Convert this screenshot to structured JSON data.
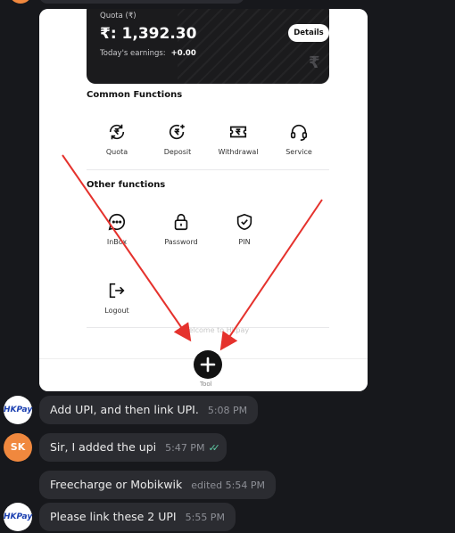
{
  "screenshot": {
    "quota_label": "Quota (₹)",
    "quota_amount": "₹: 1,392.30",
    "today_label": "Today's earnings:",
    "today_value": "+0.00",
    "details_label": "Details",
    "common_title": "Common Functions",
    "common_functions": [
      {
        "label": "Quota",
        "icon": "rupee-refresh-icon"
      },
      {
        "label": "Deposit",
        "icon": "rupee-plus-icon"
      },
      {
        "label": "Withdrawal",
        "icon": "ticket-rupee-icon"
      },
      {
        "label": "Service",
        "icon": "headset-icon"
      }
    ],
    "other_title": "Other functions",
    "other_functions": [
      {
        "label": "InBox",
        "icon": "chat-dots-icon"
      },
      {
        "label": "Password",
        "icon": "lock-icon"
      },
      {
        "label": "PIN",
        "icon": "shield-check-icon"
      },
      {
        "label": "Logout",
        "icon": "logout-icon"
      }
    ],
    "welcome_text": "Welcome to Hkpay",
    "tool_label": "Tool"
  },
  "messages": [
    {
      "sender": "HKPay",
      "avatar": "HKPay",
      "text": "Add UPI, and then link UPI.",
      "time": "5:08 PM"
    },
    {
      "sender": "SK",
      "avatar": "SK",
      "text": "Sir, I added the upi",
      "time": "5:47 PM",
      "read": true
    },
    {
      "sender": "HKPay",
      "avatar": "",
      "text": "Freecharge or Mobikwik",
      "time": "edited 5:54 PM"
    },
    {
      "sender": "HKPay",
      "avatar": "HKPay",
      "text": "Please link these 2 UPI",
      "time": "5:55 PM"
    }
  ],
  "colors": {
    "background": "#17181c",
    "bubble": "#2b2c31",
    "avatar_sk": "#f0883e",
    "arrow": "#e5322d",
    "check": "#5fc9a4"
  }
}
